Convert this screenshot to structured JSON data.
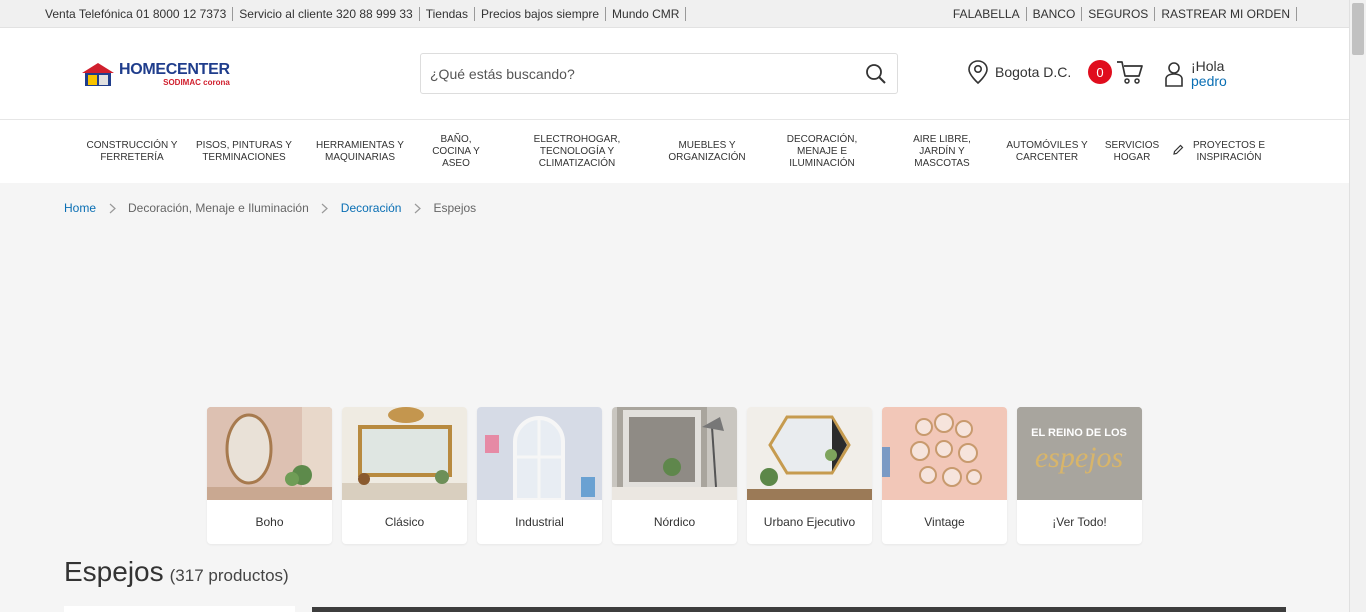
{
  "topbar": {
    "left": [
      "Venta Telefónica 01 8000 12 7373",
      "Servicio al cliente 320 88 999 33",
      "Tiendas",
      "Precios bajos siempre",
      "Mundo CMR"
    ],
    "right": [
      "FALABELLA",
      "BANCO",
      "SEGUROS",
      "RASTREAR MI ORDEN"
    ]
  },
  "logo": {
    "brand": "HOMECENTER",
    "sub": "SODIMAC corona"
  },
  "search": {
    "placeholder": "¿Qué estás buscando?",
    "value": ""
  },
  "location": {
    "label": "Bogota D.C."
  },
  "cart": {
    "count": "0"
  },
  "account": {
    "greeting": "¡Hola",
    "user": "pedro"
  },
  "categories": [
    "CONSTRUCCIÓN Y FERRETERÍA",
    "PISOS, PINTURAS Y TERMINACIONES",
    "HERRAMIENTAS Y MAQUINARIAS",
    "BAÑO, COCINA Y ASEO",
    "ELECTROHOGAR, TECNOLOGÍA Y CLIMATIZACIÓN",
    "MUEBLES Y ORGANIZACIÓN",
    "DECORACIÓN, MENAJE E ILUMINACIÓN",
    "AIRE LIBRE, JARDÍN Y MASCOTAS",
    "AUTOMÓVILES Y CARCENTER",
    "SERVICIOS HOGAR",
    "PROYECTOS E INSPIRACIÓN"
  ],
  "breadcrumb": [
    "Home",
    "Decoración, Menaje e Iluminación",
    "Decoración",
    "Espejos"
  ],
  "tiles": [
    {
      "label": "Boho",
      "tone": "#d8b8a8"
    },
    {
      "label": "Clásico",
      "tone": "#e9e3d6"
    },
    {
      "label": "Industrial",
      "tone": "#cfd6e2"
    },
    {
      "label": "Nórdico",
      "tone": "#bdb9b1"
    },
    {
      "label": "Urbano Ejecutivo",
      "tone": "#ece8e4"
    },
    {
      "label": "Vintage",
      "tone": "#f0c4b4"
    },
    {
      "label": "¡Ver Todo!",
      "promo": "EL REINO DE LOS espejos"
    }
  ],
  "heading": {
    "title": "Espejos",
    "count": "(317 productos)"
  },
  "colors": {
    "accent": "#0a6fb4",
    "badge": "#e00d1d",
    "brand": "#1f3d8c"
  }
}
